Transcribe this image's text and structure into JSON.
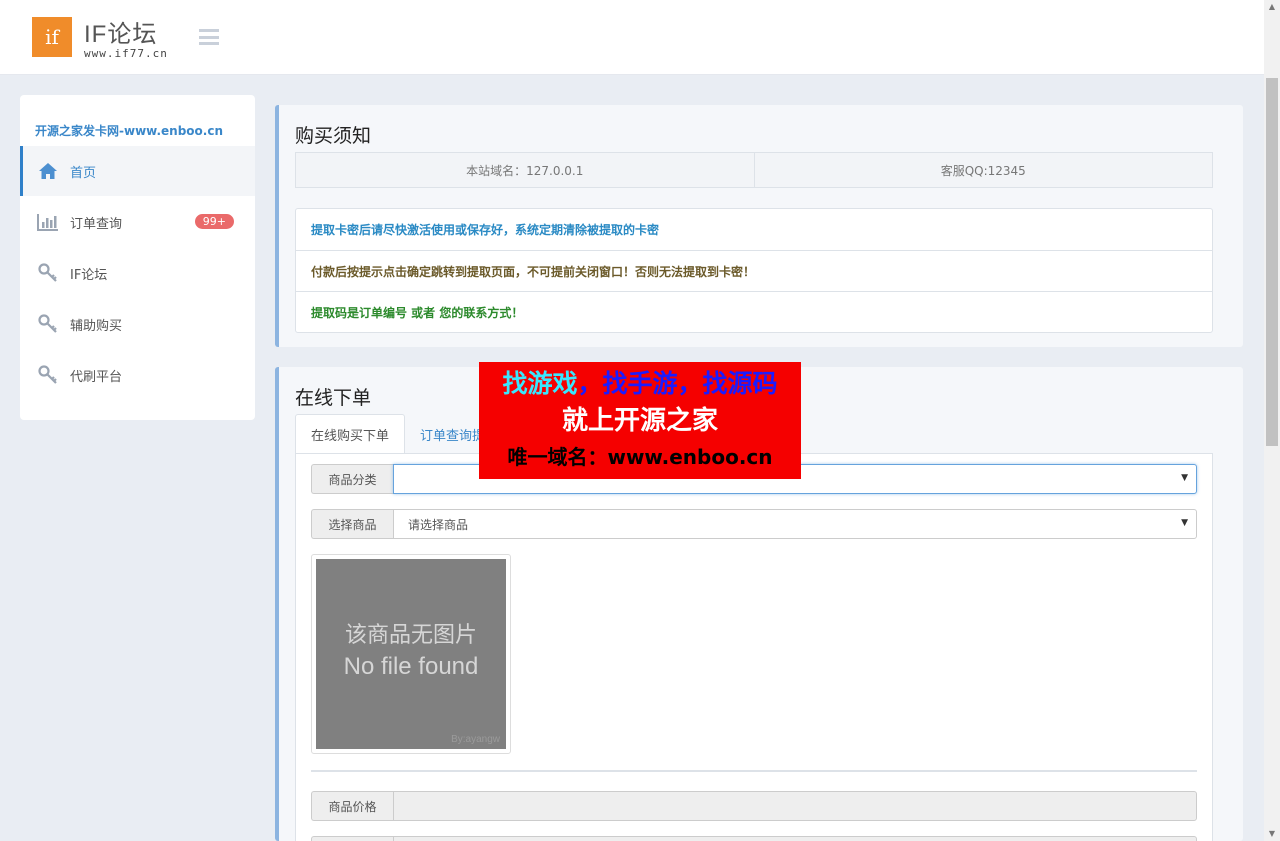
{
  "header": {
    "logo_mark": "if",
    "logo_title": "IF论坛",
    "logo_subtitle": "www.if77.cn"
  },
  "sidebar": {
    "site_name": "开源之家发卡网-www.enboo.cn",
    "items": [
      {
        "label": "首页",
        "icon": "home-icon",
        "active": true
      },
      {
        "label": "订单查询",
        "icon": "bar-chart-icon",
        "badge": "99+"
      },
      {
        "label": "IF论坛",
        "icon": "key-icon"
      },
      {
        "label": "辅助购买",
        "icon": "key-icon"
      },
      {
        "label": "代刷平台",
        "icon": "key-icon"
      }
    ]
  },
  "notice_panel": {
    "title": "购买须知",
    "info": [
      "本站域名：127.0.0.1",
      "客服QQ:12345"
    ],
    "notices": [
      "提取卡密后请尽快激活使用或保存好，系统定期清除被提取的卡密",
      "付款后按提示点击确定跳转到提取页面，不可提前关闭窗口！否则无法提取到卡密！",
      "提取码是订单编号 或者 您的联系方式！"
    ],
    "colors": {
      "notice1": "#2a8ac4",
      "notice2": "#6b5a2a",
      "notice3": "#2c8a2c"
    }
  },
  "order_panel": {
    "title": "在线下单",
    "tabs": [
      "在线购买下单",
      "订单查询提"
    ],
    "category_label": "商品分类",
    "category_value": "",
    "product_label": "选择商品",
    "product_value": "请选择商品",
    "image_placeholder": {
      "cn": "该商品无图片",
      "en": "No file found",
      "credit": "By:ayangw"
    },
    "price_label": "商品价格",
    "price_value": ""
  },
  "ad_banner": {
    "line1_part1": "找游戏",
    "line1_part2": "，找手游，找源码",
    "line2": "就上开源之家",
    "line3": "唯一域名：www.enboo.cn",
    "background": "#f50000"
  }
}
